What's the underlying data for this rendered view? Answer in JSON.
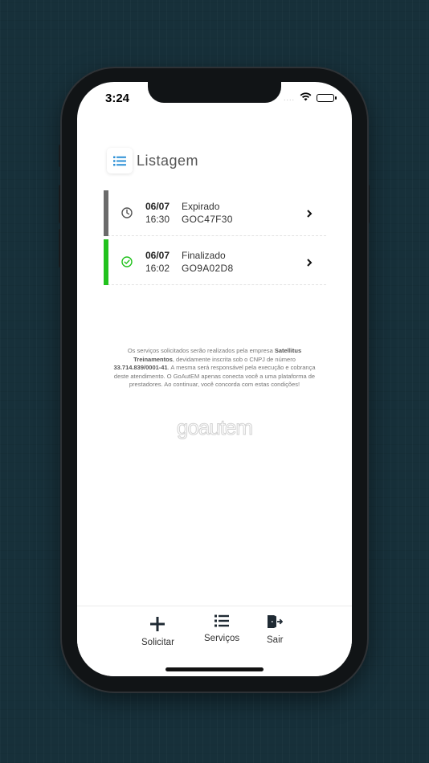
{
  "status_bar": {
    "time": "3:24",
    "signal": "....",
    "icons": [
      "wifi-icon",
      "battery-icon"
    ]
  },
  "header": {
    "icon": "list-icon",
    "title": "Listagem"
  },
  "items": [
    {
      "date": "06/07",
      "time": "16:30",
      "status": "Expirado",
      "code": "GOC47F30",
      "status_icon": "clock-icon",
      "accent_color": "#6b6b6b"
    },
    {
      "date": "06/07",
      "time": "16:02",
      "status": "Finalizado",
      "code": "GO9A02D8",
      "status_icon": "check-circle-icon",
      "accent_color": "#22c21d"
    }
  ],
  "disclaimer": {
    "part1": "Os serviços solicitados serão realizados pela empresa ",
    "company": "Satellitus Treinamentos",
    "part2": ", devidamente inscrita sob o CNPJ de número ",
    "cnpj": "33.714.839/0001-41",
    "part3": ". A mesma será responsável pela execução e cobrança deste atendimento. O GoAutEM apenas conecta você a uma plataforma de prestadores. Ao continuar, você concorda com estas condições!"
  },
  "logo_text": "goautem",
  "bottom_nav": [
    {
      "label": "Solicitar",
      "icon": "plus-icon"
    },
    {
      "label": "Serviços",
      "icon": "list-icon"
    },
    {
      "label": "Sair",
      "icon": "exit-door-icon"
    }
  ],
  "colors": {
    "accent_blue": "#2a8fd6",
    "expired_gray": "#6b6b6b",
    "done_green": "#22c21d",
    "background": "#17303a"
  }
}
